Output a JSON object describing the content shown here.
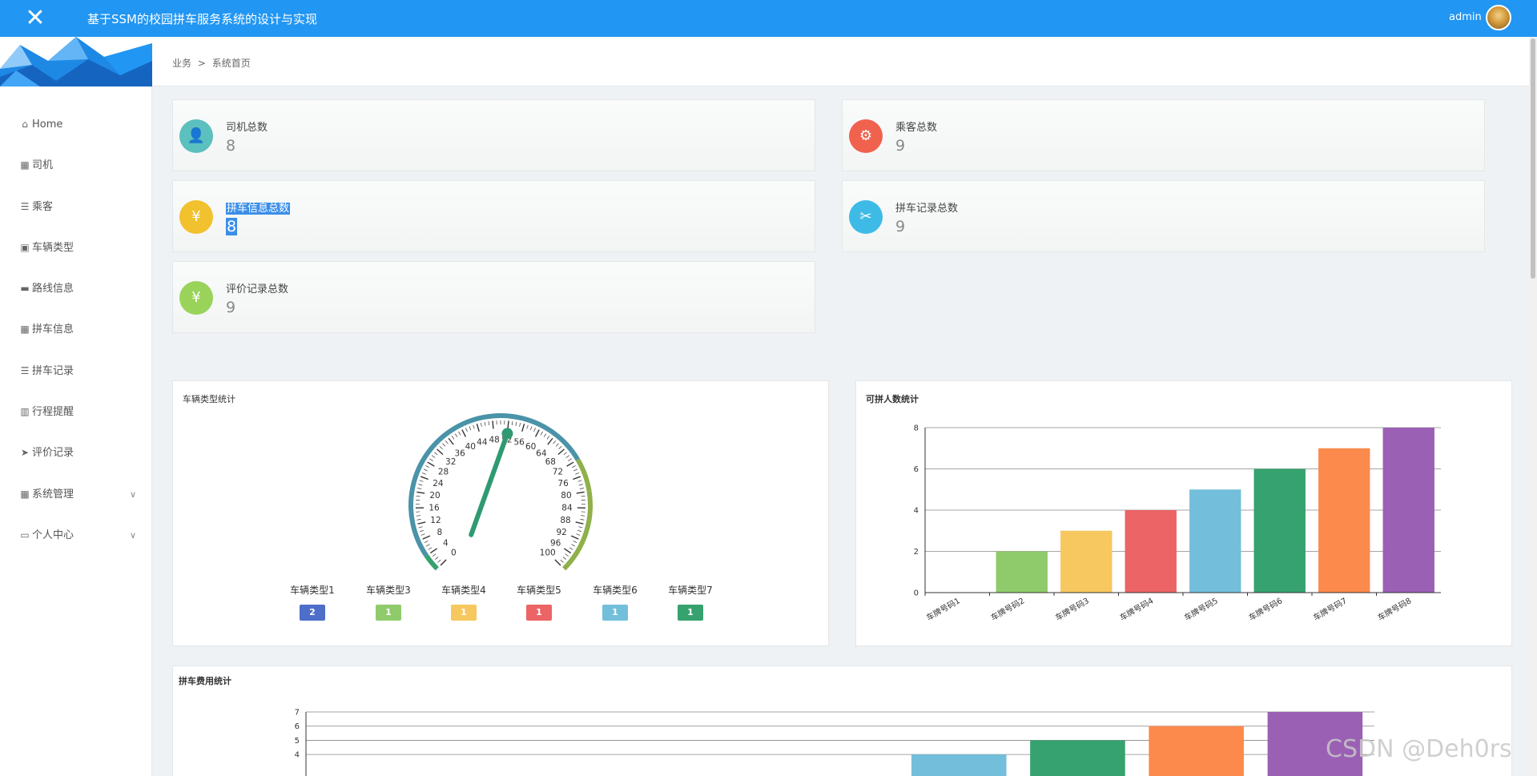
{
  "topbar": {
    "title": "基于SSM的校园拼车服务系统的设计与实现",
    "close_glyph": "✕",
    "user": "admin"
  },
  "sidebar": {
    "items": [
      {
        "label": "Home",
        "icon": "home-icon"
      },
      {
        "label": "司机",
        "icon": "grid-icon"
      },
      {
        "label": "乘客",
        "icon": "list-icon"
      },
      {
        "label": "车辆类型",
        "icon": "clipboard-icon"
      },
      {
        "label": "路线信息",
        "icon": "ticket-icon"
      },
      {
        "label": "拼车信息",
        "icon": "grid-icon"
      },
      {
        "label": "拼车记录",
        "icon": "list-icon"
      },
      {
        "label": "行程提醒",
        "icon": "bar-chart-icon"
      },
      {
        "label": "评价记录",
        "icon": "send-icon"
      },
      {
        "label": "系统管理",
        "icon": "grid-icon",
        "expandable": true
      },
      {
        "label": "个人中心",
        "icon": "id-card-icon",
        "expandable": true
      }
    ]
  },
  "breadcrumb": {
    "parent": "业务",
    "separator": ">",
    "current": "系统首页"
  },
  "stats": [
    {
      "label": "司机总数",
      "value": "8",
      "color": "#5bc0be",
      "icon": "user-card-icon"
    },
    {
      "label": "乘客总数",
      "value": "9",
      "color": "#f0624d",
      "icon": "gear-icon"
    },
    {
      "label": "拼车信息总数",
      "value": "8",
      "color": "#f2c12e",
      "icon": "yen-card-icon"
    },
    {
      "label": "拼车记录总数",
      "value": "9",
      "color": "#3dbbe6",
      "icon": "tools-icon"
    },
    {
      "label": "评价记录总数",
      "value": "9",
      "color": "#9ad35a",
      "icon": "yen-ticket-icon"
    }
  ],
  "gauge_panel": {
    "title": "车辆类型统计",
    "legend": [
      {
        "name": "车辆类型1",
        "value": "2",
        "color": "#4e6ec9"
      },
      {
        "name": "车辆类型3",
        "value": "1",
        "color": "#8fcb6b"
      },
      {
        "name": "车辆类型4",
        "value": "1",
        "color": "#f6c85f"
      },
      {
        "name": "车辆类型5",
        "value": "1",
        "color": "#ec6465"
      },
      {
        "name": "车辆类型6",
        "value": "1",
        "color": "#73bfdb"
      },
      {
        "name": "车辆类型7",
        "value": "1",
        "color": "#36a26f"
      }
    ]
  },
  "chart_data": [
    {
      "type": "gauge",
      "title": "车辆类型统计",
      "min": 0,
      "max": 100,
      "tick_labels": [
        "0",
        "4",
        "8",
        "12",
        "16",
        "20",
        "24",
        "28",
        "32",
        "36",
        "40",
        "44",
        "48",
        "52",
        "56",
        "60",
        "64",
        "68",
        "72",
        "76",
        "80",
        "84",
        "88",
        "92",
        "96",
        "100"
      ],
      "value": 52
    },
    {
      "type": "bar",
      "title": "可拼人数统计",
      "categories": [
        "车牌号码1",
        "车牌号码2",
        "车牌号码3",
        "车牌号码4",
        "车牌号码5",
        "车牌号码6",
        "车牌号码7",
        "车牌号码8"
      ],
      "values": [
        0,
        2,
        3,
        4,
        5,
        6,
        7,
        8
      ],
      "colors": [
        "#4e6ec9",
        "#8fcb6b",
        "#f6c85f",
        "#ec6465",
        "#73bfdb",
        "#36a26f",
        "#fb8a4c",
        "#9a60b4"
      ],
      "yticks": [
        "0",
        "2",
        "4",
        "6",
        "8"
      ],
      "ylim": [
        0,
        8
      ],
      "grid": true
    },
    {
      "type": "bar",
      "title": "拼车费用统计",
      "values": [
        0,
        0,
        0,
        0,
        0,
        4,
        5,
        6,
        7
      ],
      "colors": [
        "#4e6ec9",
        "#8fcb6b",
        "#f6c85f",
        "#ec6465",
        "#73bfdb",
        "#73bfdb",
        "#36a26f",
        "#fb8a4c",
        "#9a60b4"
      ],
      "yticks": [
        "4",
        "5",
        "6",
        "7"
      ],
      "ylim": [
        0,
        7
      ],
      "grid": true
    }
  ],
  "watermark": "CSDN @Deh0rs"
}
